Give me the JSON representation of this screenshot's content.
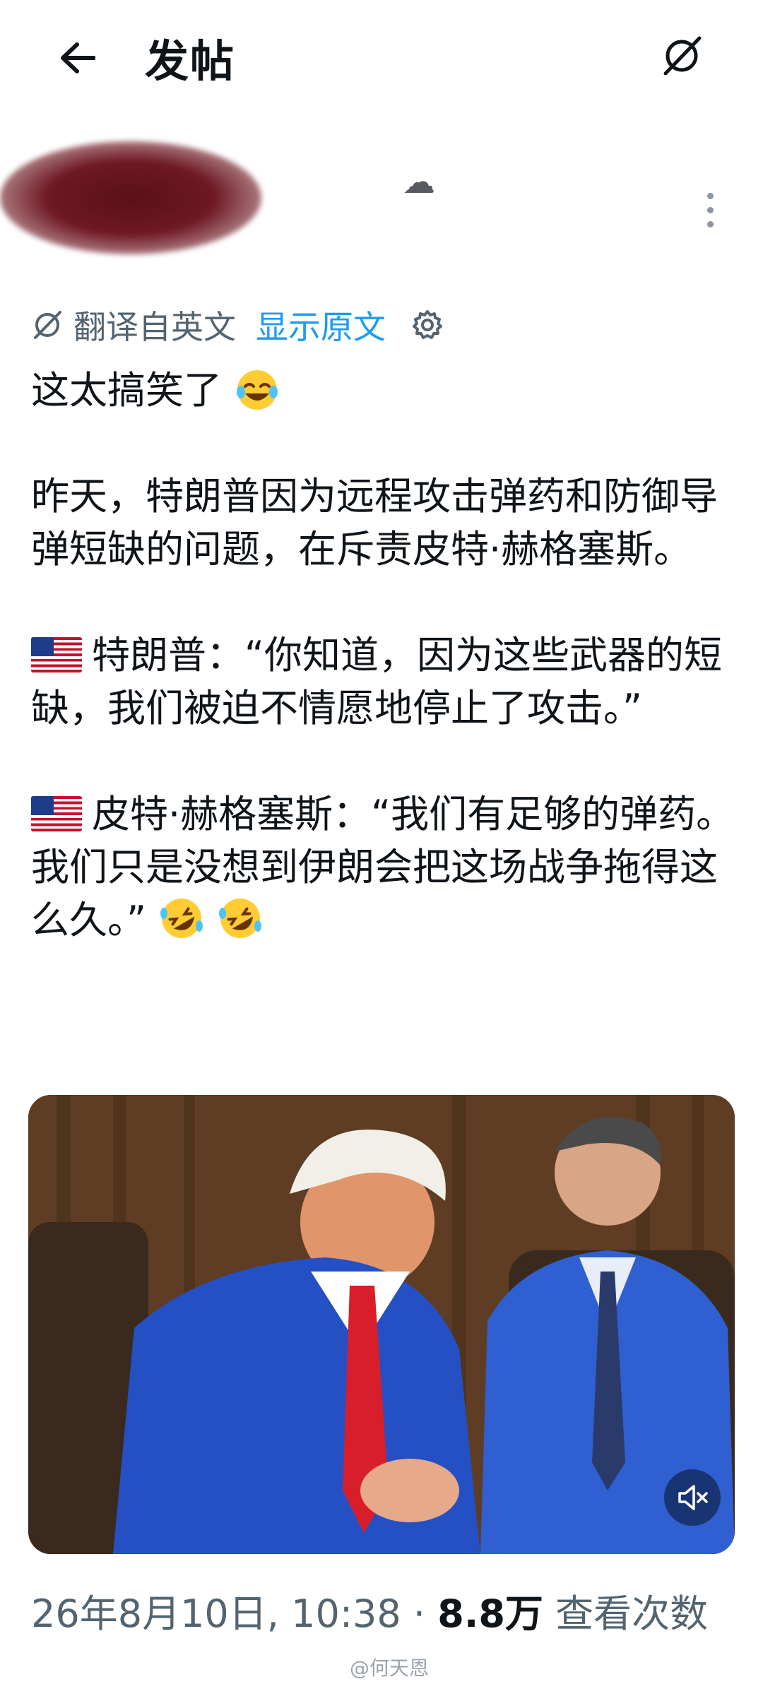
{
  "header": {
    "title": "发帖"
  },
  "translation": {
    "label": "翻译自英文",
    "show_original": "显示原文"
  },
  "post": {
    "line1": "这太搞笑了",
    "para2": "昨天，特朗普因为远程攻击弹药和防御导弹短缺的问题，在斥责皮特·赫格塞斯。",
    "para3": "特朗普：“你知道，因为这些武器的短缺，我们被迫不情愿地停止了攻击。”",
    "para4": "皮特·赫格塞斯：“我们有足够的弹药。我们只是没想到伊朗会把这场战争拖得这么久。”"
  },
  "meta": {
    "date": "26年8月10日, 10:38",
    "separator": "·",
    "views_count": "8.8万",
    "views_label": "查看次数"
  },
  "watermark": "@何天恩",
  "colors": {
    "accent": "#1d9bf0",
    "text": "#0f1419",
    "secondary": "#536471"
  },
  "icons": {
    "back": "arrow-left-icon",
    "translate": "translate-slash-icon",
    "more": "vertical-dots-icon",
    "gear": "gear-icon",
    "mute": "speaker-muted-icon",
    "flag": "us-flag-emoji",
    "emoji_joy": "face-with-tears-of-joy",
    "emoji_rofl": "rolling-on-floor-laughing"
  }
}
